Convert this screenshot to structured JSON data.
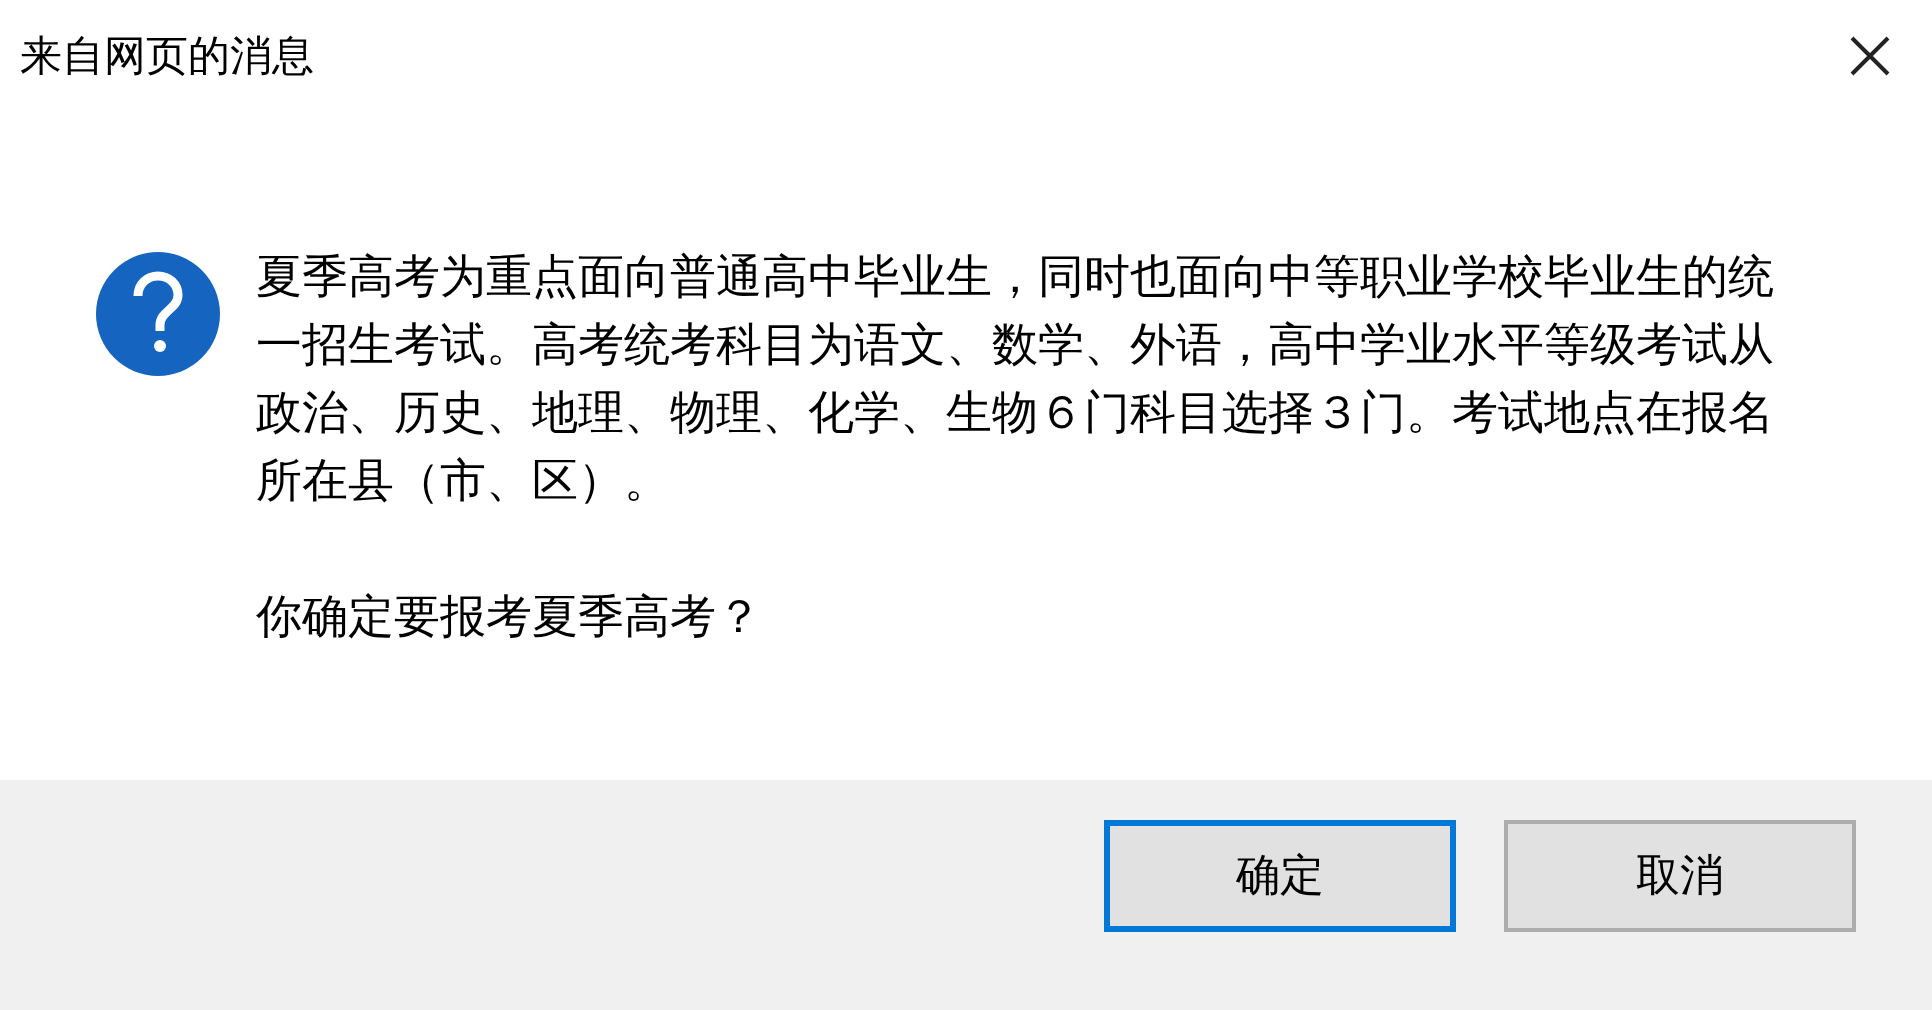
{
  "window": {
    "title": "来自网页的消息"
  },
  "message": "夏季高考为重点面向普通高中毕业生，同时也面向中等职业学校毕业生的统一招生考试。高考统考科目为语文、数学、外语，高中学业水平等级考试从政治、历史、地理、物理、化学、生物６门科目选择３门。考试地点在报名所在县（市、区）。",
  "question": "你确定要报考夏季高考？",
  "buttons": [
    {
      "label": "确定",
      "focused": true
    },
    {
      "label": "取消",
      "focused": false
    }
  ]
}
